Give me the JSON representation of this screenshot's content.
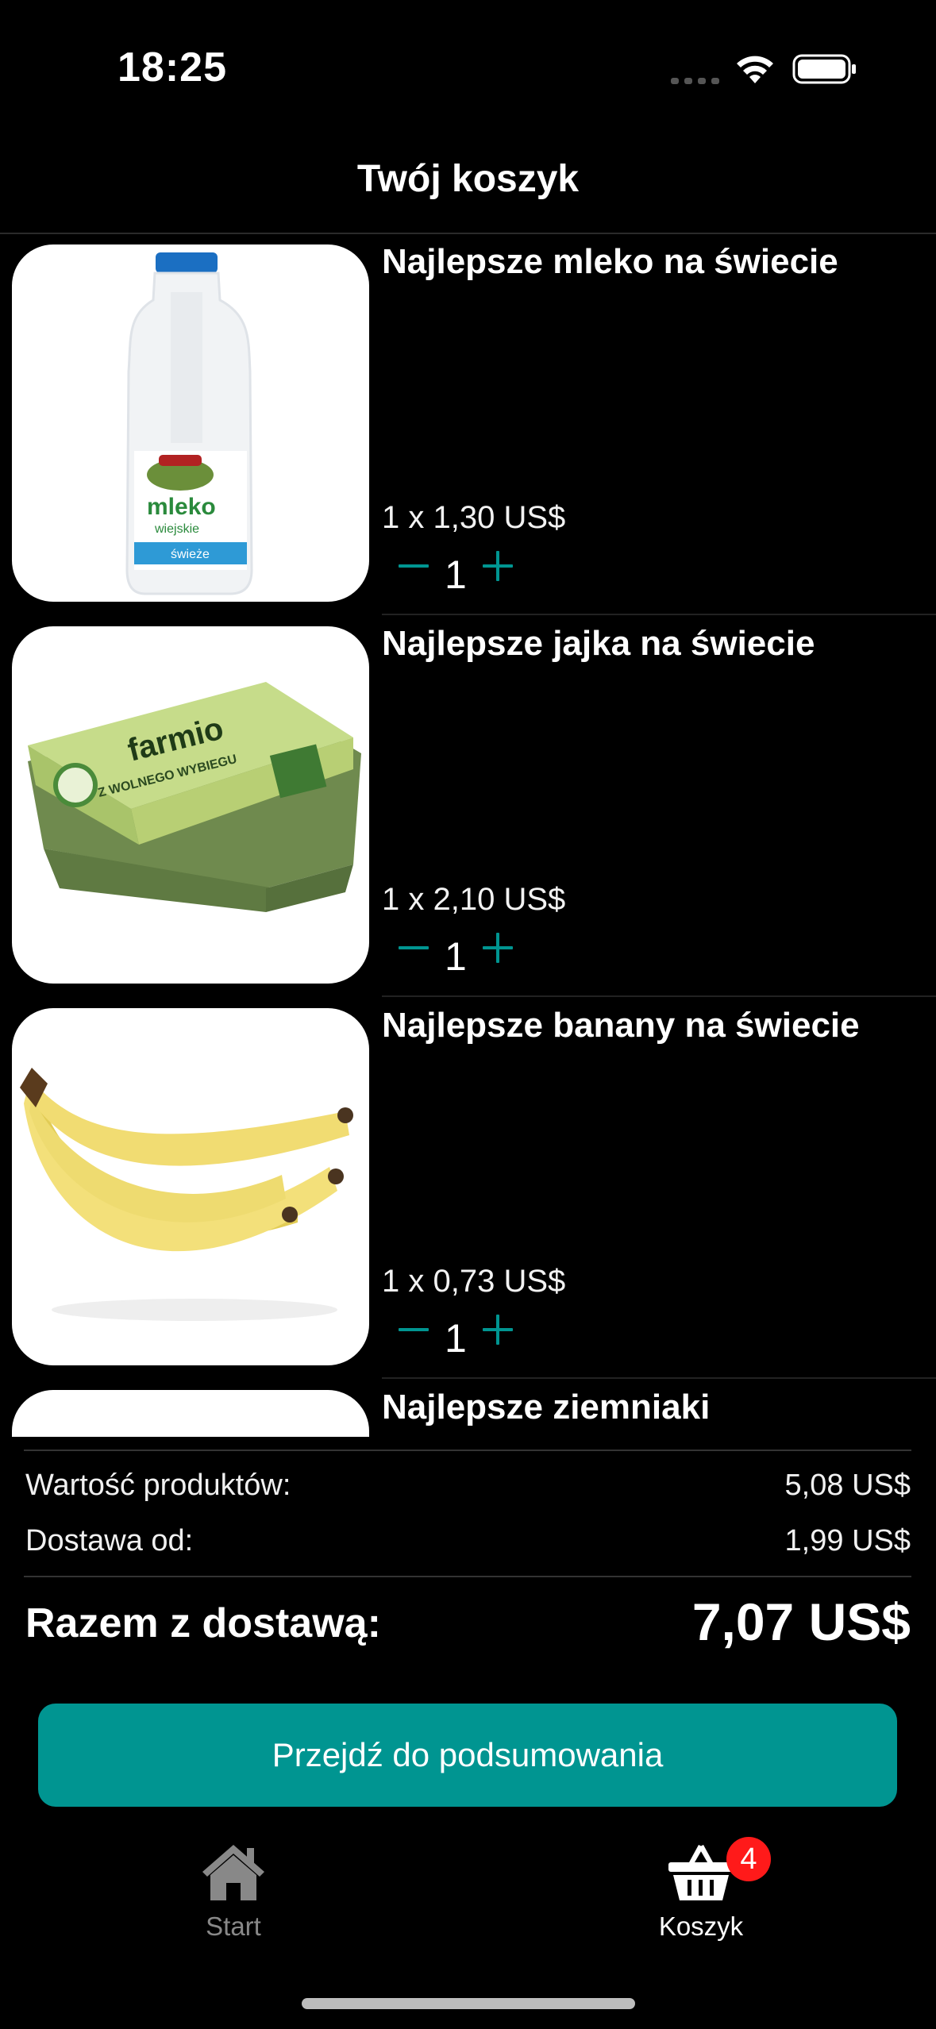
{
  "status_bar": {
    "time": "18:25"
  },
  "nav": {
    "title": "Twój koszyk"
  },
  "cart_items": [
    {
      "name": "Najlepsze mleko na świecie",
      "price_line": "1 x 1,30 US$",
      "quantity": "1",
      "image": "milk-bottle"
    },
    {
      "name": "Najlepsze jajka na świecie",
      "price_line": "1 x 2,10 US$",
      "quantity": "1",
      "image": "egg-carton"
    },
    {
      "name": "Najlepsze banany na świecie",
      "price_line": "1 x 0,73 US$",
      "quantity": "1",
      "image": "bananas"
    },
    {
      "name": "Najlepsze ziemniaki",
      "image": "potatoes"
    }
  ],
  "summary": {
    "products_label": "Wartość produktów:",
    "products_value": "5,08 US$",
    "delivery_label": "Dostawa od:",
    "delivery_value": "1,99 US$",
    "total_label": "Razem z dostawą:",
    "total_value": "7,07 US$"
  },
  "checkout_button": {
    "label": "Przejdź do podsumowania",
    "color": "#009591"
  },
  "tab_bar": {
    "tabs": [
      {
        "label": "Start",
        "icon": "house-icon",
        "active": false
      },
      {
        "label": "Koszyk",
        "icon": "basket-icon",
        "active": true,
        "badge": "4"
      }
    ]
  },
  "colors": {
    "accent": "#009591",
    "badge": "#ff1a1a",
    "background": "#000000"
  }
}
